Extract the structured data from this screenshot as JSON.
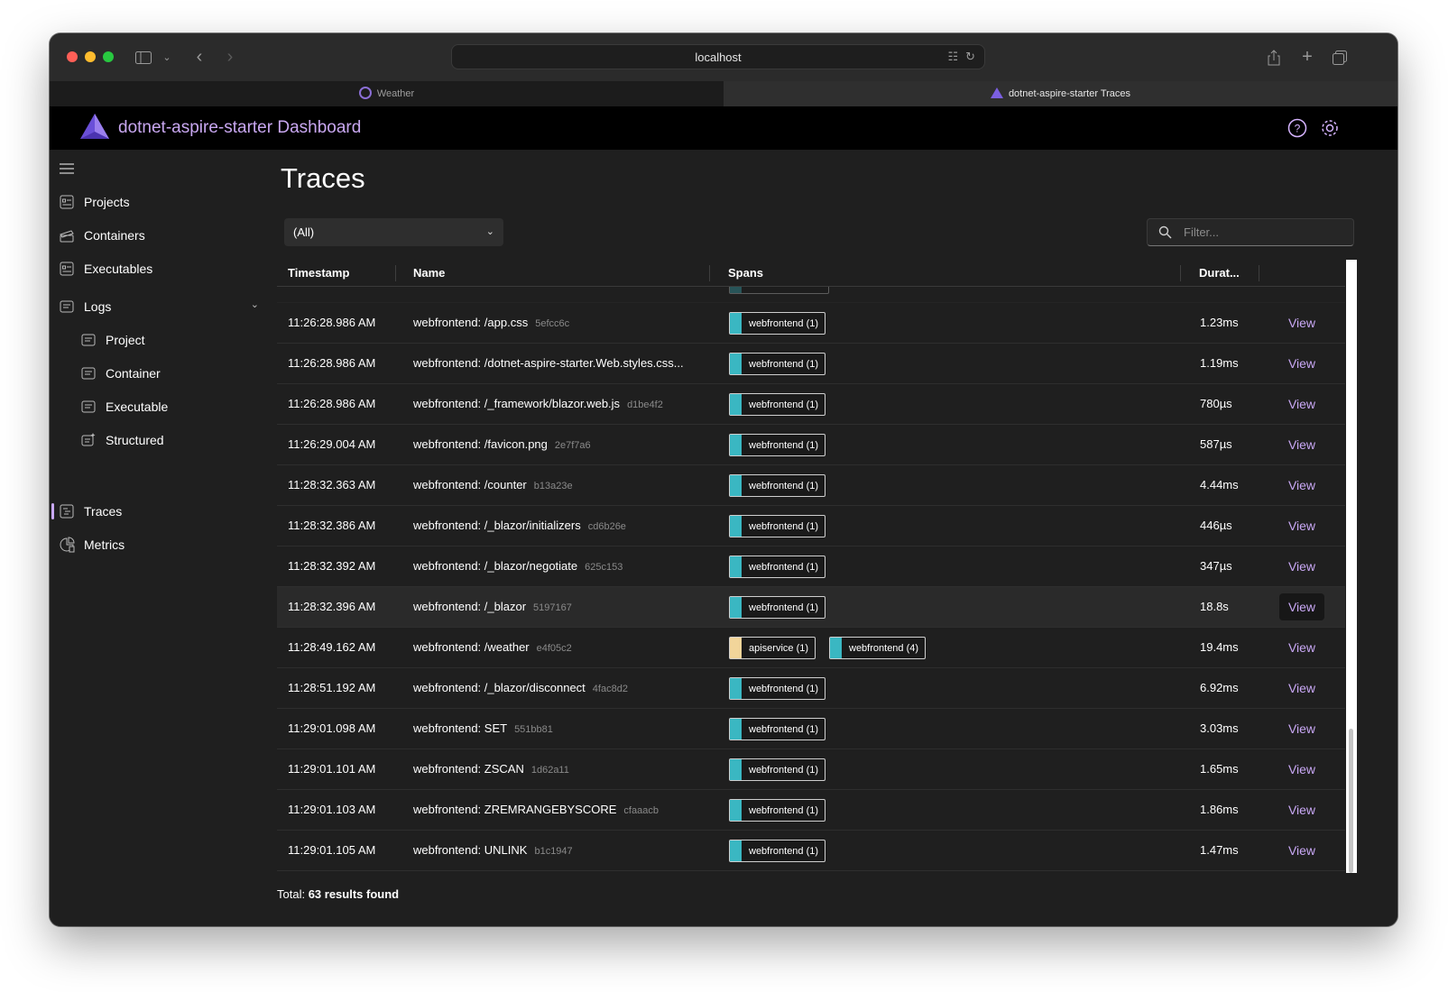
{
  "browser": {
    "url": "localhost",
    "tabs": [
      {
        "label": "Weather",
        "active": false
      },
      {
        "label": "dotnet-aspire-starter Traces",
        "active": true
      }
    ]
  },
  "app": {
    "title": "dotnet-aspire-starter Dashboard",
    "accent": "#c9a8f5"
  },
  "sidebar": {
    "items": [
      {
        "label": "Projects",
        "icon": "projects-icon"
      },
      {
        "label": "Containers",
        "icon": "containers-icon"
      },
      {
        "label": "Executables",
        "icon": "executables-icon"
      },
      {
        "label": "Logs",
        "icon": "logs-icon"
      },
      {
        "label": "Project",
        "icon": "log-project-icon"
      },
      {
        "label": "Container",
        "icon": "log-container-icon"
      },
      {
        "label": "Executable",
        "icon": "log-executable-icon"
      },
      {
        "label": "Structured",
        "icon": "log-structured-icon"
      },
      {
        "label": "Traces",
        "icon": "traces-icon",
        "selected": true
      },
      {
        "label": "Metrics",
        "icon": "metrics-icon"
      }
    ]
  },
  "main": {
    "title": "Traces",
    "select_value": "(All)",
    "filter_placeholder": "Filter...",
    "columns": [
      "Timestamp",
      "Name",
      "Spans",
      "Durat..."
    ],
    "rows": [
      {
        "time": "11:26:28.986 AM",
        "name": "webfrontend: /app.css",
        "id": "5efcc6c",
        "spans": [
          {
            "label": "webfrontend (1)",
            "color": "#3ab7c2"
          }
        ],
        "duration": "1.23ms",
        "view": "View"
      },
      {
        "time": "11:26:28.986 AM",
        "name": "webfrontend: /dotnet-aspire-starter.Web.styles.css...",
        "id": "",
        "spans": [
          {
            "label": "webfrontend (1)",
            "color": "#3ab7c2"
          }
        ],
        "duration": "1.19ms",
        "view": "View"
      },
      {
        "time": "11:26:28.986 AM",
        "name": "webfrontend: /_framework/blazor.web.js",
        "id": "d1be4f2",
        "spans": [
          {
            "label": "webfrontend (1)",
            "color": "#3ab7c2"
          }
        ],
        "duration": "780µs",
        "view": "View"
      },
      {
        "time": "11:26:29.004 AM",
        "name": "webfrontend: /favicon.png",
        "id": "2e7f7a6",
        "spans": [
          {
            "label": "webfrontend (1)",
            "color": "#3ab7c2"
          }
        ],
        "duration": "587µs",
        "view": "View"
      },
      {
        "time": "11:28:32.363 AM",
        "name": "webfrontend: /counter",
        "id": "b13a23e",
        "spans": [
          {
            "label": "webfrontend (1)",
            "color": "#3ab7c2"
          }
        ],
        "duration": "4.44ms",
        "view": "View"
      },
      {
        "time": "11:28:32.386 AM",
        "name": "webfrontend: /_blazor/initializers",
        "id": "cd6b26e",
        "spans": [
          {
            "label": "webfrontend (1)",
            "color": "#3ab7c2"
          }
        ],
        "duration": "446µs",
        "view": "View"
      },
      {
        "time": "11:28:32.392 AM",
        "name": "webfrontend: /_blazor/negotiate",
        "id": "625c153",
        "spans": [
          {
            "label": "webfrontend (1)",
            "color": "#3ab7c2"
          }
        ],
        "duration": "347µs",
        "view": "View"
      },
      {
        "time": "11:28:32.396 AM",
        "name": "webfrontend: /_blazor",
        "id": "5197167",
        "spans": [
          {
            "label": "webfrontend (1)",
            "color": "#3ab7c2"
          }
        ],
        "duration": "18.8s",
        "view": "View",
        "highlight": true
      },
      {
        "time": "11:28:49.162 AM",
        "name": "webfrontend: /weather",
        "id": "e4f05c2",
        "spans": [
          {
            "label": "apiservice (1)",
            "color": "#f2d59a"
          },
          {
            "label": "webfrontend (4)",
            "color": "#3ab7c2"
          }
        ],
        "duration": "19.4ms",
        "view": "View"
      },
      {
        "time": "11:28:51.192 AM",
        "name": "webfrontend: /_blazor/disconnect",
        "id": "4fac8d2",
        "spans": [
          {
            "label": "webfrontend (1)",
            "color": "#3ab7c2"
          }
        ],
        "duration": "6.92ms",
        "view": "View"
      },
      {
        "time": "11:29:01.098 AM",
        "name": "webfrontend: SET",
        "id": "551bb81",
        "spans": [
          {
            "label": "webfrontend (1)",
            "color": "#3ab7c2"
          }
        ],
        "duration": "3.03ms",
        "view": "View"
      },
      {
        "time": "11:29:01.101 AM",
        "name": "webfrontend: ZSCAN",
        "id": "1d62a11",
        "spans": [
          {
            "label": "webfrontend (1)",
            "color": "#3ab7c2"
          }
        ],
        "duration": "1.65ms",
        "view": "View"
      },
      {
        "time": "11:29:01.103 AM",
        "name": "webfrontend: ZREMRANGEBYSCORE",
        "id": "cfaaacb",
        "spans": [
          {
            "label": "webfrontend (1)",
            "color": "#3ab7c2"
          }
        ],
        "duration": "1.86ms",
        "view": "View"
      },
      {
        "time": "11:29:01.105 AM",
        "name": "webfrontend: UNLINK",
        "id": "b1c1947",
        "spans": [
          {
            "label": "webfrontend (1)",
            "color": "#3ab7c2"
          }
        ],
        "duration": "1.47ms",
        "view": "View"
      }
    ],
    "total_prefix": "Total: ",
    "total_count": "63 results found"
  }
}
